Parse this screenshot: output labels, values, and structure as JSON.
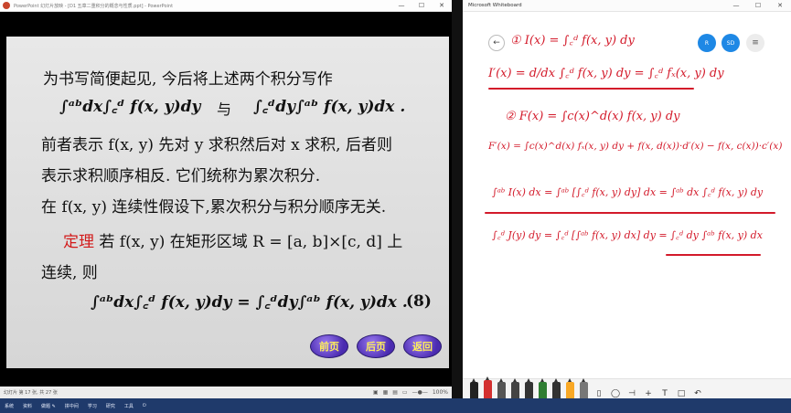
{
  "ppt": {
    "title": "PowerPoint 幻灯片放映 - [D1 五章二重积分的概念与性质.ppt] - PowerPoint",
    "slide": {
      "line1": "为书写简便起见, 今后将上述两个积分写作",
      "formula_a": "∫ᵃᵇdx∫꜀ᵈ f(x, y)dy",
      "yu": "与",
      "formula_b": "∫꜀ᵈdy∫ᵃᵇ f(x, y)dx .",
      "line2": "前者表示 f(x, y) 先对 y 求积然后对 x 求积, 后者则",
      "line3": "表示求积顺序相反. 它们统称为累次积分.",
      "line4": "在 f(x, y) 连续性假设下,累次积分与积分顺序无关.",
      "theorem_word": "定理",
      "line5_rest": " 若 f(x, y) 在矩形区域 R = [a, b]×[c, d] 上",
      "line6": "连续, 则",
      "formula_main": "∫ᵃᵇdx∫꜀ᵈ f(x, y)dy = ∫꜀ᵈdy∫ᵃᵇ f(x, y)dx .",
      "eq_number": "(8)",
      "nav": {
        "prev": "前页",
        "next": "后页",
        "back": "返回"
      }
    },
    "status": {
      "slide_info": "幻灯片 第 17 张, 共 27 张",
      "zoom": "100%"
    }
  },
  "taskbar": [
    "系统",
    "资料",
    "做题 ✎",
    "拼中间",
    "学习",
    "研究",
    "工具"
  ],
  "whiteboard": {
    "title": "Microsoft Whiteboard",
    "avatar1": "R",
    "avatar2": "SD",
    "ink": [
      "① I(x) = ∫꜀ᵈ f(x, y) dy",
      "I′(x) = d/dx ∫꜀ᵈ f(x, y) dy = ∫꜀ᵈ fₓ(x, y) dy",
      "② F(x) = ∫c(x)^d(x) f(x, y) dy",
      "F′(x) = ∫c(x)^d(x) fₓ(x, y) dy + f(x, d(x))·d′(x) − f(x, c(x))·c′(x)",
      "∫ᵃᵇ I(x) dx = ∫ᵃᵇ [∫꜀ᵈ f(x, y) dy] dx = ∫ᵃᵇ dx ∫꜀ᵈ f(x, y) dy",
      "∫꜀ᵈ J(y) dy = ∫꜀ᵈ [∫ᵃᵇ f(x, y) dx] dy = ∫꜀ᵈ dy ∫ᵃᵇ f(x, y) dx"
    ],
    "pen_colors": [
      "#222222",
      "#d32f2f",
      "#555555",
      "#444444",
      "#333333",
      "#2e7d32",
      "#333333",
      "#f9a825",
      "#777777"
    ]
  }
}
